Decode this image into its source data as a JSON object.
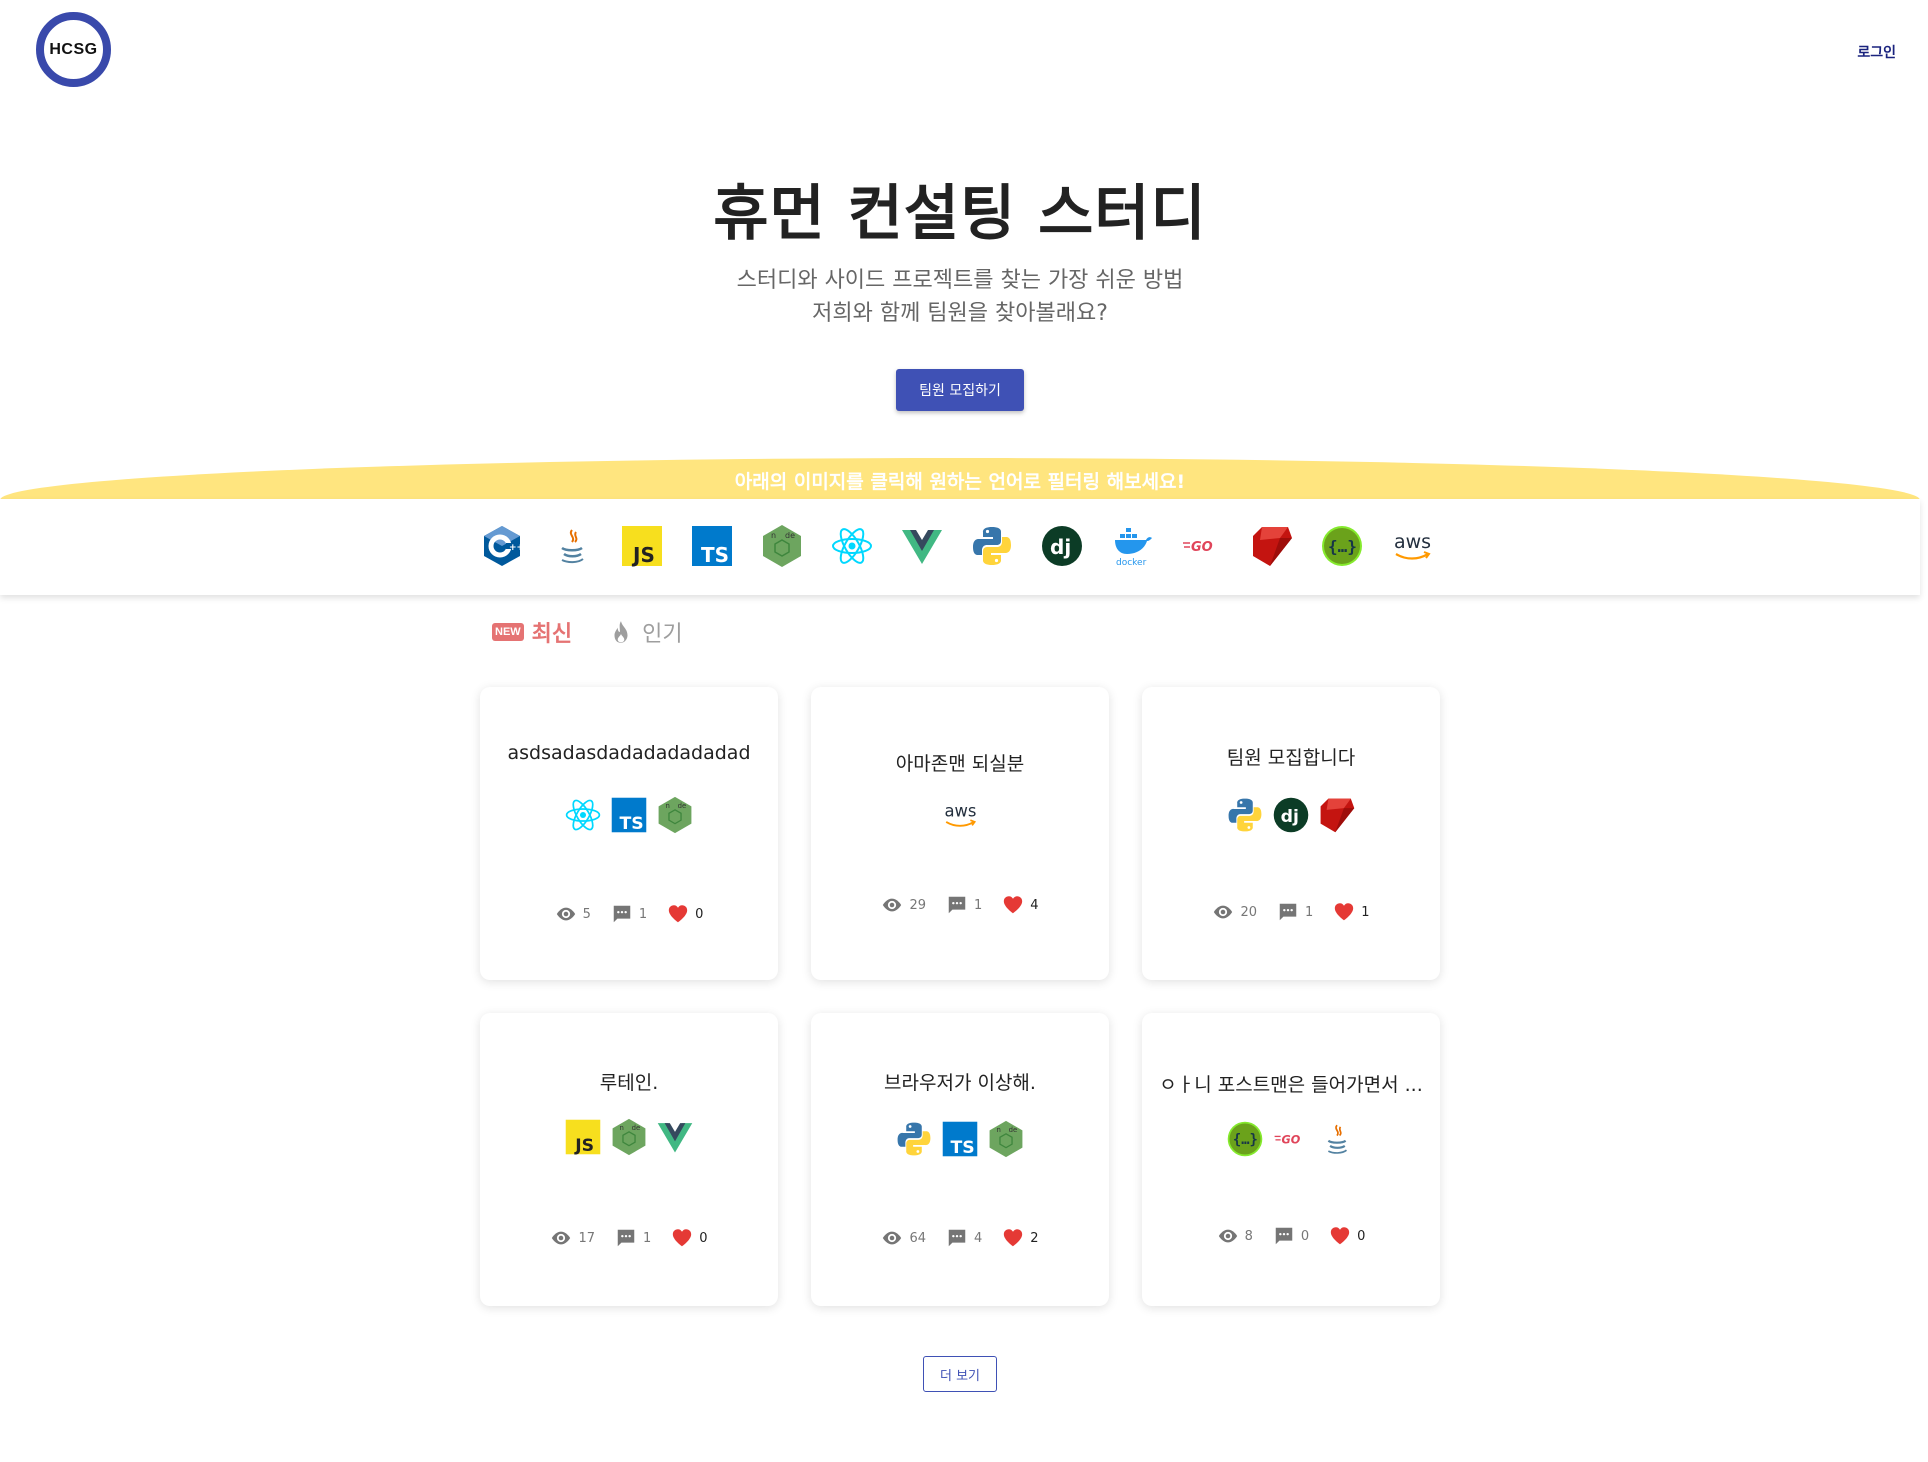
{
  "header": {
    "logo_text": "HCSG",
    "login_label": "로그인"
  },
  "hero": {
    "title": "휴먼 컨설팅 스터디",
    "subtitle_line1": "스터디와 사이드 프로젝트를 찾는 가장 쉬운 방법",
    "subtitle_line2": "저희와 함께 팀원을 찾아볼래요?",
    "cta_label": "팀원 모집하기"
  },
  "filter": {
    "banner_text": "아래의 이미지를 클릭해 원하는 언어로 필터링 해보세요!",
    "languages": [
      "c++-icon",
      "java-icon",
      "javascript-icon",
      "typescript-icon",
      "nodejs-icon",
      "react-icon",
      "vue-icon",
      "python-icon",
      "django-icon",
      "docker-icon",
      "go-icon",
      "ruby-icon",
      "swagger-icon",
      "aws-icon"
    ]
  },
  "tabs": {
    "new_badge": "NEW",
    "latest": "최신",
    "popular": "인기"
  },
  "posts": [
    {
      "title": "asdsadasdadadadadadad",
      "stacks": [
        "react",
        "typescript",
        "nodejs"
      ],
      "views": "5",
      "comments": "1",
      "likes": "0"
    },
    {
      "title": "아마존맨 되실분",
      "stacks": [
        "aws"
      ],
      "views": "29",
      "comments": "1",
      "likes": "4"
    },
    {
      "title": "팀원 모집합니다",
      "stacks": [
        "python",
        "django",
        "ruby"
      ],
      "views": "20",
      "comments": "1",
      "likes": "1"
    },
    {
      "title": "루테인.",
      "stacks": [
        "javascript",
        "nodejs",
        "vue"
      ],
      "views": "17",
      "comments": "1",
      "likes": "0"
    },
    {
      "title": "브라우저가 이상해.",
      "stacks": [
        "python",
        "typescript",
        "nodejs"
      ],
      "views": "64",
      "comments": "4",
      "likes": "2"
    },
    {
      "title": "ㅇㅏ니 포스트맨은 들어가면서 ...",
      "stacks": [
        "swagger",
        "go",
        "java"
      ],
      "views": "8",
      "comments": "0",
      "likes": "0"
    }
  ],
  "more_label": "더 보기",
  "colors": {
    "primary": "#3f51b5",
    "banner": "#ffe57f",
    "accent_red": "#e57373",
    "heart": "#e53935"
  }
}
